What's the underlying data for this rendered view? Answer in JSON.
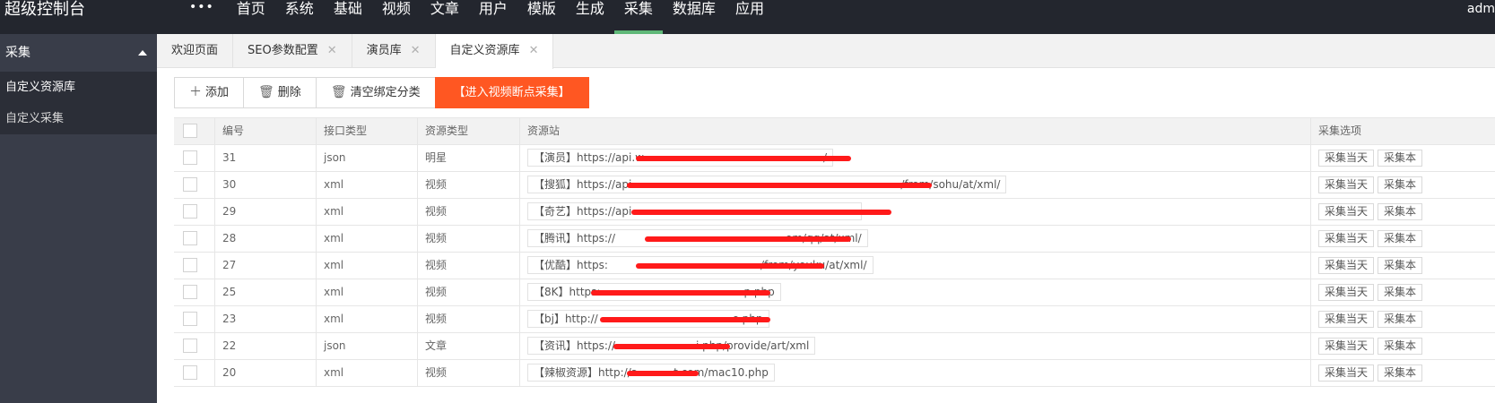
{
  "app": {
    "title": "超级控制台",
    "user": "adm"
  },
  "topnav": {
    "more": "•••",
    "items": [
      "首页",
      "系统",
      "基础",
      "视频",
      "文章",
      "用户",
      "模版",
      "生成",
      "采集",
      "数据库",
      "应用"
    ],
    "active": "采集"
  },
  "sidebar": {
    "group": "采集",
    "items": [
      "自定义资源库",
      "自定义采集"
    ]
  },
  "tabs": [
    {
      "label": "欢迎页面"
    },
    {
      "label": "SEO参数配置"
    },
    {
      "label": "演员库"
    },
    {
      "label": "自定义资源库"
    }
  ],
  "toolbar": {
    "add": "添加",
    "delete": "删除",
    "clear": "清空绑定分类",
    "breakpoint": "【进入视频断点采集】"
  },
  "table": {
    "headers": {
      "id": "编号",
      "type": "接口类型",
      "rtype": "资源类型",
      "site": "资源站",
      "opt": "采集选项"
    },
    "rows": [
      {
        "id": "31",
        "type": "json",
        "rtype": "明星",
        "site": "【演员】https://api.w",
        "site_tail": "/",
        "opt1": "采集当天",
        "opt2": "采集本"
      },
      {
        "id": "30",
        "type": "xml",
        "rtype": "视频",
        "site": "【搜狐】https://api",
        "site_tail": "/from/sohu/at/xml/",
        "opt1": "采集当天",
        "opt2": "采集本"
      },
      {
        "id": "29",
        "type": "xml",
        "rtype": "视频",
        "site": "【奇艺】https://api",
        "site_tail": "",
        "opt1": "采集当天",
        "opt2": "采集本"
      },
      {
        "id": "28",
        "type": "xml",
        "rtype": "视频",
        "site": "【腾讯】https://",
        "site_tail": "om/qq/at/xml/",
        "opt1": "采集当天",
        "opt2": "采集本"
      },
      {
        "id": "27",
        "type": "xml",
        "rtype": "视频",
        "site": "【优酷】https:",
        "site_tail": "/from/youku/at/xml/",
        "opt1": "采集当天",
        "opt2": "采集本"
      },
      {
        "id": "25",
        "type": "xml",
        "rtype": "视频",
        "site": "【8K】https:",
        "site_tail": "p.php",
        "opt1": "采集当天",
        "opt2": "采集本"
      },
      {
        "id": "23",
        "type": "xml",
        "rtype": "视频",
        "site": "【bj】http://",
        "site_tail": "o.php",
        "opt1": "采集当天",
        "opt2": "采集本"
      },
      {
        "id": "22",
        "type": "json",
        "rtype": "文章",
        "site": "【资讯】https://",
        "site_tail": "i.php/provide/art/xml",
        "opt1": "采集当天",
        "opt2": "采集本"
      },
      {
        "id": "20",
        "type": "xml",
        "rtype": "视频",
        "site": "【辣椒资源】http://a",
        "site_tail": "t.com/mac10.php",
        "opt1": "采集当天",
        "opt2": "采集本"
      }
    ]
  },
  "colors": {
    "header": "#23262e",
    "sidebar": "#393d49",
    "accent": "#5fb878",
    "primary": "#ff5722",
    "redaction": "#ff1a1a"
  }
}
